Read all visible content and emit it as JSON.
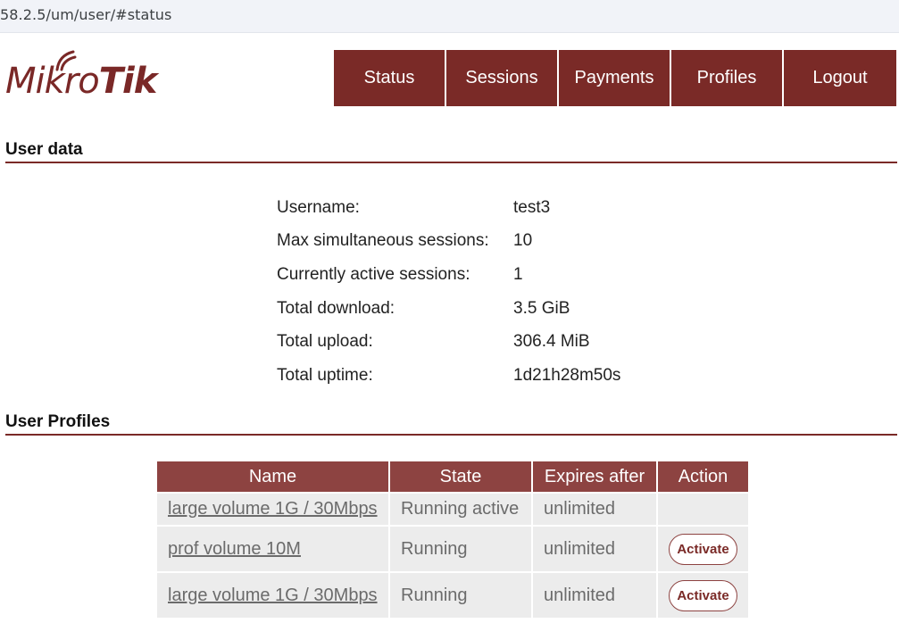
{
  "browser": {
    "url": "58.2.5/um/user/#status"
  },
  "logo": {
    "light": "Mikro",
    "heavy": "Tik"
  },
  "nav": {
    "items": [
      {
        "label": "Status"
      },
      {
        "label": "Sessions"
      },
      {
        "label": "Payments"
      },
      {
        "label": "Profiles"
      },
      {
        "label": "Logout"
      }
    ]
  },
  "user_data": {
    "title": "User data",
    "rows": [
      {
        "key": "Username:",
        "value": "test3"
      },
      {
        "key": "Max simultaneous sessions:",
        "value": "10"
      },
      {
        "key": "Currently active sessions:",
        "value": "1"
      },
      {
        "key": "Total download:",
        "value": "3.5 GiB"
      },
      {
        "key": "Total upload:",
        "value": "306.4 MiB"
      },
      {
        "key": "Total uptime:",
        "value": "1d21h28m50s"
      }
    ]
  },
  "user_profiles": {
    "title": "User Profiles",
    "columns": [
      "Name",
      "State",
      "Expires after",
      "Action"
    ],
    "rows": [
      {
        "name": "large volume 1G / 30Mbps",
        "state": "Running active",
        "expires": "unlimited",
        "action": ""
      },
      {
        "name": "prof volume 10M",
        "state": "Running",
        "expires": "unlimited",
        "action": "Activate"
      },
      {
        "name": "large volume 1G / 30Mbps",
        "state": "Running",
        "expires": "unlimited",
        "action": "Activate"
      }
    ]
  },
  "colors": {
    "brand": "#7a2a27",
    "table_header": "#8d4341",
    "cell_bg": "#ececec"
  }
}
